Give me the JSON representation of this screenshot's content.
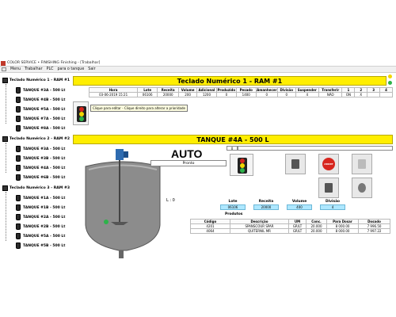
{
  "window": {
    "title": "COLOR SERVICE • FINISHING Finishing - [Trabalhar]"
  },
  "menu": {
    "items": [
      "Menu",
      "Trabalhar",
      "PLC",
      "para o tanque",
      "Sair"
    ]
  },
  "sidebar": {
    "groups": [
      {
        "label": "Teclado Numérico 1 - RAM #1",
        "tanks": [
          "TANQUE #3A - 500 Lt",
          "TANQUE #4B - 500 Lt",
          "TANQUE #5A - 500 Lt",
          "TANQUE #7A - 500 Lt",
          "TANQUE #8A - 500 Lt"
        ]
      },
      {
        "label": "Teclado Numérico 2 - RAM #2",
        "tanks": [
          "TANQUE #3A - 500 Lt",
          "TANQUE #3B - 500 Lt",
          "TANQUE #4A - 500 Lt",
          "TANQUE #6B - 500 Lt"
        ]
      },
      {
        "label": "Teclado Numérico 3 - RAM #3",
        "tanks": [
          "TANQUE #1A - 500 Lt",
          "TANQUE #1B - 500 Lt",
          "TANQUE #2A - 500 Lt",
          "TANQUE #2B - 500 Lt",
          "TANQUE #5A - 500 Lt",
          "TANQUE #5B - 500 Lt"
        ]
      }
    ]
  },
  "keypad": {
    "banner": "Teclado Numérico 1 - RAM #1",
    "headers": [
      "Hora",
      "Lote",
      "Receita",
      "Volume",
      "Adicional",
      "Produzido",
      "Pesado",
      "Amanhecer",
      "Divisão",
      "Suspender",
      "Transferir",
      "1",
      "2",
      "3",
      "4"
    ],
    "row": [
      "03-06-2019 15:21",
      "06106",
      "20000",
      "200",
      "1200",
      "0",
      "1400",
      "0",
      "0",
      "4",
      "NÃO",
      "ON",
      "X",
      "",
      ""
    ],
    "tooltip": "Clique para editar - Clique direito para alterar a prioridade"
  },
  "tank": {
    "banner": "TANQUE #4A - 500 L",
    "mode": "AUTO",
    "status": "Pronto",
    "level_value": "0",
    "level_text": "L : 0",
    "stop_label": "ABORT",
    "info_headers": [
      "Lote",
      "Receita",
      "Volume",
      "Divisão"
    ],
    "info_values": [
      "06106",
      "20000",
      "400",
      "4"
    ],
    "produtos_title": "Produtos",
    "product_headers": [
      "Código",
      "Descrição",
      "UM",
      "Conc.",
      "Para Dosar",
      "Dosado"
    ],
    "products": [
      [
        "4201",
        "SPANSCOUR SPAR",
        "GR/LT",
        "20.000",
        "8 000.00",
        "7 996.50"
      ],
      [
        "4064",
        "QUITERNIL MR",
        "GR/LT",
        "20.000",
        "8 000.00",
        "7 997.22"
      ]
    ]
  },
  "colors": {
    "banner_yellow": "#ffee00",
    "cyan_field": "#aee7ff",
    "stop_red": "#d7261e",
    "indicator_yellow": "#f2d600",
    "indicator_green": "#2db34a"
  }
}
